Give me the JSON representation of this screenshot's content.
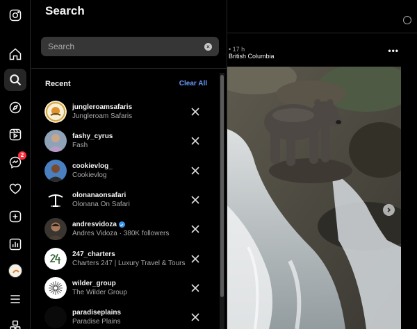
{
  "search_panel": {
    "title": "Search",
    "search_placeholder": "Search",
    "recent_heading": "Recent",
    "clear_all_label": "Clear All",
    "recent_items": [
      {
        "username": "jungleroamsafaris",
        "subtitle": "Jungleroam Safaris",
        "verified": false
      },
      {
        "username": "fashy_cyrus",
        "subtitle": "Fash",
        "verified": false
      },
      {
        "username": "cookievlog_",
        "subtitle": "Cookievlog",
        "verified": false
      },
      {
        "username": "olonanaonsafari",
        "subtitle": "Olonana On Safari",
        "verified": false
      },
      {
        "username": "andresvidoza",
        "subtitle": "Andres Vidoza · 380K followers",
        "verified": true
      },
      {
        "username": "247_charters",
        "subtitle": "Charters 247 | Luxury Travel & Tours",
        "verified": false
      },
      {
        "username": "wilder_group",
        "subtitle": "The Wilder Group",
        "verified": false
      },
      {
        "username": "paradiseplains",
        "subtitle": "Paradise Plains",
        "verified": false
      }
    ]
  },
  "sidebar": {
    "notification_badge": "2",
    "icons": [
      "instagram-logo-icon",
      "home-icon",
      "search-icon",
      "explore-icon",
      "reels-icon",
      "messages-icon",
      "notifications-heart-icon",
      "create-icon",
      "dashboard-icon",
      "profile-avatar",
      "menu-icon",
      "more-icon"
    ]
  },
  "feed": {
    "post_time": "• 17 h",
    "post_location": "British Columbia",
    "more_options": "•••"
  },
  "colors": {
    "background": "#000000",
    "search_field": "#363636",
    "link_blue": "#6b9bff",
    "badge_red": "#ff3040",
    "verified_blue": "#3897f0"
  }
}
